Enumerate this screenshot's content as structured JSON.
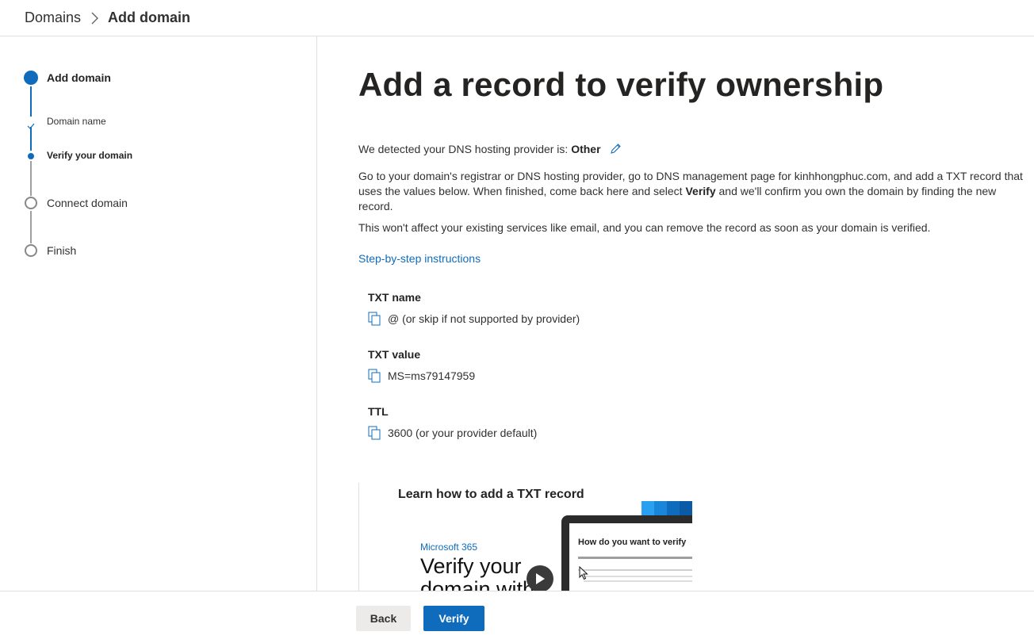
{
  "breadcrumb": {
    "parent": "Domains",
    "current": "Add domain"
  },
  "stepper": {
    "steps": [
      {
        "label": "Add domain",
        "state": "current"
      },
      {
        "label": "Domain name",
        "state": "completed-substep"
      },
      {
        "label": "Verify your domain",
        "state": "current-substep"
      },
      {
        "label": "Connect domain",
        "state": "not-started"
      },
      {
        "label": "Finish",
        "state": "not-started"
      }
    ]
  },
  "main": {
    "title": "Add a record to verify ownership",
    "detected_prefix": "We detected your DNS hosting provider is: ",
    "detected_provider": "Other",
    "instructions_1": "Go to your domain's registrar or DNS hosting provider, go to DNS management page for kinhhongphuc.com, and add a TXT record that uses the values below. When finished, come back here and select ",
    "instructions_bold": "Verify",
    "instructions_2": " and we'll confirm you own the domain by finding the new record.",
    "note": "This won't affect your existing services like email, and you can remove the record as soon as your domain is verified.",
    "link_label": "Step-by-step instructions",
    "records": [
      {
        "label": "TXT name",
        "value": "@ (or skip if not supported by provider)"
      },
      {
        "label": "TXT value",
        "value": "MS=ms79147959"
      },
      {
        "label": "TTL",
        "value": "3600 (or your provider default)"
      }
    ],
    "video": {
      "title": "Learn how to add a TXT record",
      "brand": "Microsoft 365",
      "heading_line1": "Verify your",
      "heading_line2": "domain with",
      "screen_title": "How do you want to verify"
    }
  },
  "footer": {
    "back_label": "Back",
    "verify_label": "Verify"
  },
  "colors": {
    "accent": "#0f6cbd",
    "border": "#e1dfdd",
    "text": "#323130"
  }
}
